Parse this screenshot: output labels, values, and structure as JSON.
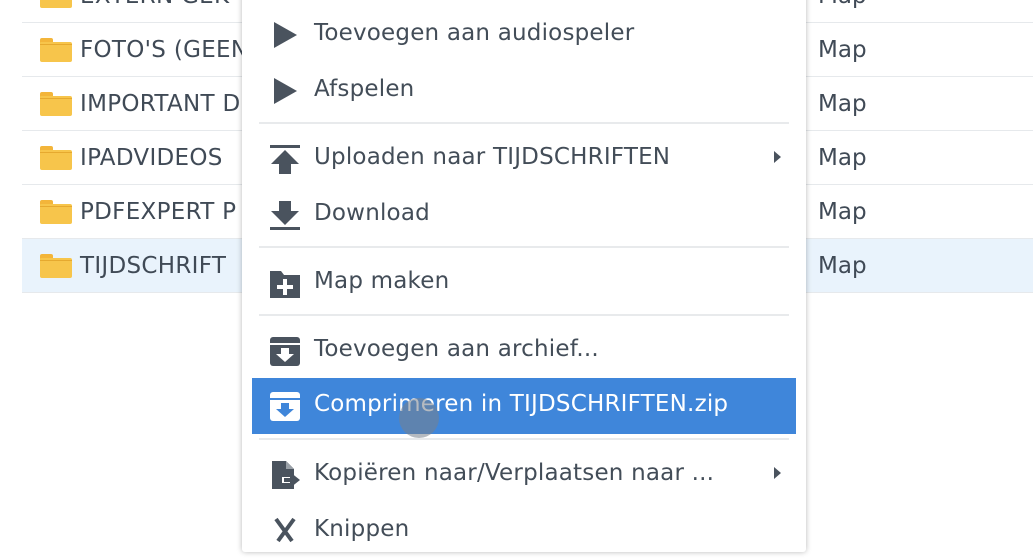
{
  "files": [
    {
      "name": "EXTERN GEK",
      "type": "Map"
    },
    {
      "name": "FOTO'S (GEEN",
      "type": "Map"
    },
    {
      "name": "IMPORTANT D",
      "type": "Map"
    },
    {
      "name": "IPADVIDEOS",
      "type": "Map"
    },
    {
      "name": "PDFEXPERT P",
      "type": "Map"
    },
    {
      "name": "TIJDSCHRIFT",
      "type": "Map",
      "selected": true
    }
  ],
  "context_menu": {
    "items": [
      {
        "label": "Toevoegen aan audiospeler",
        "icon": "play-icon"
      },
      {
        "label": "Afspelen",
        "icon": "play-icon"
      },
      {
        "label": "Uploaden naar TIJDSCHRIFTEN",
        "icon": "upload-icon",
        "submenu": true
      },
      {
        "label": "Download",
        "icon": "download-icon"
      },
      {
        "label": "Map maken",
        "icon": "add-folder-icon"
      },
      {
        "label": "Toevoegen aan archief...",
        "icon": "archive-icon"
      },
      {
        "label": "Comprimeren in TIJDSCHRIFTEN.zip",
        "icon": "archive-icon",
        "highlighted": true
      },
      {
        "label": "Kopiëren naar/Verplaatsen naar ...",
        "icon": "copy-move-icon",
        "submenu": true
      },
      {
        "label": "Knippen",
        "icon": "scissors-icon"
      }
    ]
  },
  "colors": {
    "highlight": "#3f86da",
    "selected_row": "#e9f3fc",
    "folder": "#f7c54b",
    "icon": "#4a535e"
  }
}
